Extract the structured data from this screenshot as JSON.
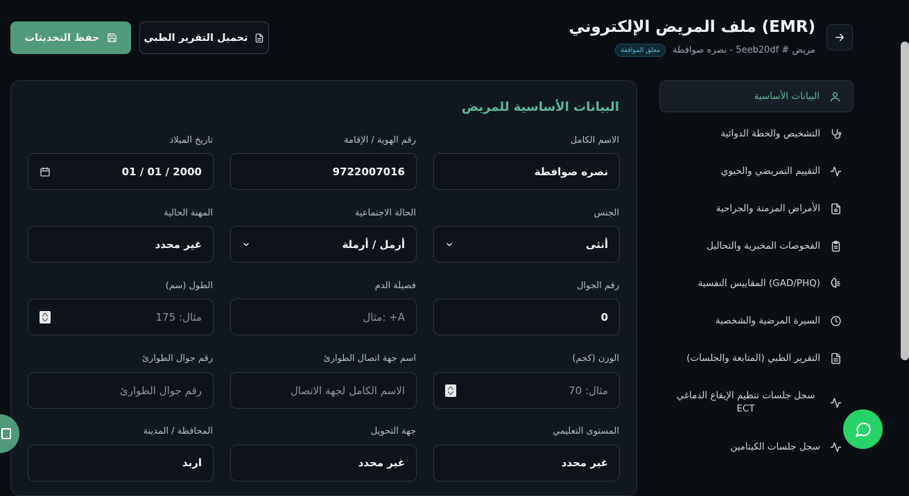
{
  "header": {
    "title": "ملف المريض الإلكتروني (EMR)",
    "patient_line": "مريض # 5eeb20df - نصره صوافطة",
    "status_badge": "معلق الموافقة",
    "download_label": "تحميل التقرير الطبي",
    "save_label": "حفظ التحديثات"
  },
  "sidebar": {
    "items": [
      {
        "label": "البيانات الأساسية",
        "icon": "user-icon",
        "active": true
      },
      {
        "label": "التشخيص والخطة الدوائية",
        "icon": "stethoscope-icon"
      },
      {
        "label": "التقييم التمريضي والحيوي",
        "icon": "activity-icon"
      },
      {
        "label": "الأمراض المزمنة والجراحية",
        "icon": "file-medical-icon"
      },
      {
        "label": "الفحوصات المخبرية والتحاليل",
        "icon": "clipboard-icon"
      },
      {
        "label": "المقاييس النفسية (GAD/PHQ)",
        "icon": "brain-icon"
      },
      {
        "label": "السيرة المرضية والشخصية",
        "icon": "clock-icon"
      },
      {
        "label": "التقرير الطبي (المتابعة والجلسات)",
        "icon": "document-icon"
      },
      {
        "label": "سجل جلسات تنظيم الإيقاع الدماغي ECT",
        "icon": "activity-icon"
      },
      {
        "label": "سجل جلسات الكيتامين",
        "icon": "activity-icon"
      }
    ]
  },
  "form": {
    "title": "البيانات الأساسية للمريض",
    "full_name": {
      "label": "الاسم الكامل",
      "value": "نصره صوافطة"
    },
    "national_id": {
      "label": "رقم الهوية / الإقامة",
      "value": "9722007016"
    },
    "birth_date": {
      "label": "تاريخ الميلاد",
      "value": "01 / 01 / 2000"
    },
    "gender": {
      "label": "الجنس",
      "value": "أنثى"
    },
    "marital_status": {
      "label": "الحالة الاجتماعية",
      "value": "أرمل / أرملة"
    },
    "occupation": {
      "label": "المهنة الحالية",
      "value": "غير محدد"
    },
    "mobile": {
      "label": "رقم الجوال",
      "value": "0"
    },
    "blood_type": {
      "label": "فصيلة الدم",
      "placeholder": "مثال: +A"
    },
    "height": {
      "label": "الطول (سم)",
      "placeholder": "مثال: 175"
    },
    "weight": {
      "label": "الوزن (كجم)",
      "placeholder": "مثال: 70"
    },
    "emergency_name": {
      "label": "اسم جهة اتصال الطوارئ",
      "placeholder": "الاسم الكامل لجهة الاتصال"
    },
    "emergency_phone": {
      "label": "رقم جوال الطوارئ",
      "placeholder": "رقم جوال الطوارئ"
    },
    "education": {
      "label": "المستوى التعليمي",
      "value": "غير محدد"
    },
    "referral": {
      "label": "جهة التحويل",
      "value": "غير محدد"
    },
    "city": {
      "label": "المحافظة / المدينة",
      "value": "اربد"
    }
  },
  "colors": {
    "accent": "#5fb896",
    "save_button": "#4f9a7a",
    "chat": "#25d366",
    "background": "#0b0f14"
  }
}
